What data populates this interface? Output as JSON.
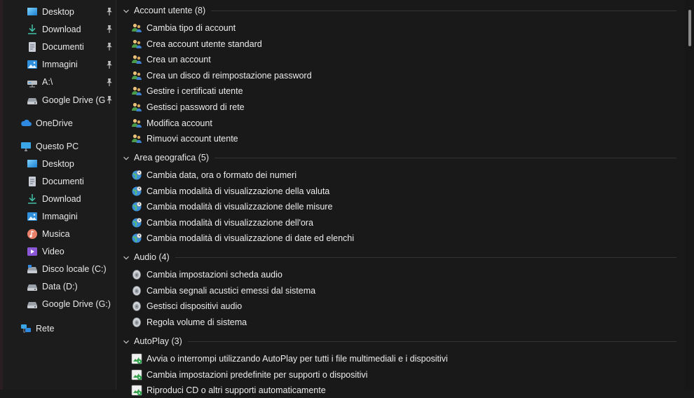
{
  "sidebar": {
    "quick_access": [
      {
        "label": "Desktop",
        "icon": "desktop-icon",
        "pinned": true
      },
      {
        "label": "Download",
        "icon": "download-icon",
        "pinned": true
      },
      {
        "label": "Documenti",
        "icon": "documents-icon",
        "pinned": true
      },
      {
        "label": "Immagini",
        "icon": "pictures-icon",
        "pinned": true
      },
      {
        "label": "A:\\",
        "icon": "network-drive-icon",
        "pinned": true
      },
      {
        "label": "Google Drive (G",
        "icon": "drive-icon",
        "pinned": true
      }
    ],
    "onedrive": {
      "label": "OneDrive",
      "icon": "cloud-icon"
    },
    "this_pc": {
      "label": "Questo PC",
      "icon": "computer-icon"
    },
    "this_pc_items": [
      {
        "label": "Desktop",
        "icon": "desktop-icon"
      },
      {
        "label": "Documenti",
        "icon": "documents-icon"
      },
      {
        "label": "Download",
        "icon": "download-icon"
      },
      {
        "label": "Immagini",
        "icon": "pictures-icon"
      },
      {
        "label": "Musica",
        "icon": "music-icon"
      },
      {
        "label": "Video",
        "icon": "video-icon"
      },
      {
        "label": "Disco locale (C:)",
        "icon": "system-drive-icon"
      },
      {
        "label": "Data (D:)",
        "icon": "drive-icon"
      },
      {
        "label": "Google Drive (G:)",
        "icon": "drive-icon"
      }
    ],
    "network": {
      "label": "Rete",
      "icon": "network-icon"
    }
  },
  "groups": [
    {
      "title": "Account utente (8)",
      "icon": "users-icon",
      "items": [
        "Cambia tipo di account",
        "Crea account utente standard",
        "Crea un account",
        "Crea un disco di reimpostazione password",
        "Gestire i certificati utente",
        "Gestisci password di rete",
        "Modifica account",
        "Rimuovi account utente"
      ]
    },
    {
      "title": "Area geografica (5)",
      "icon": "globe-clock-icon",
      "items": [
        "Cambia data, ora o formato dei numeri",
        "Cambia modalità di visualizzazione della valuta",
        "Cambia modalità di visualizzazione delle misure",
        "Cambia modalità di visualizzazione dell'ora",
        "Cambia modalità di visualizzazione di date ed elenchi"
      ]
    },
    {
      "title": "Audio (4)",
      "icon": "speaker-icon",
      "items": [
        "Cambia impostazioni scheda audio",
        "Cambia segnali acustici emessi dal sistema",
        "Gestisci dispositivi audio",
        "Regola volume di sistema"
      ]
    },
    {
      "title": "AutoPlay (3)",
      "icon": "autoplay-icon",
      "items": [
        "Avvia o interrompi utilizzando AutoPlay per tutti i file multimediali e i dispositivi",
        "Cambia impostazioni predefinite per supporti o dispositivi",
        "Riproduci CD o altri supporti automaticamente"
      ]
    }
  ],
  "colors": {
    "background": "#191919",
    "sidebar": "#1c1c1c",
    "text": "#e6e6e6",
    "accent": "#0078d4"
  }
}
